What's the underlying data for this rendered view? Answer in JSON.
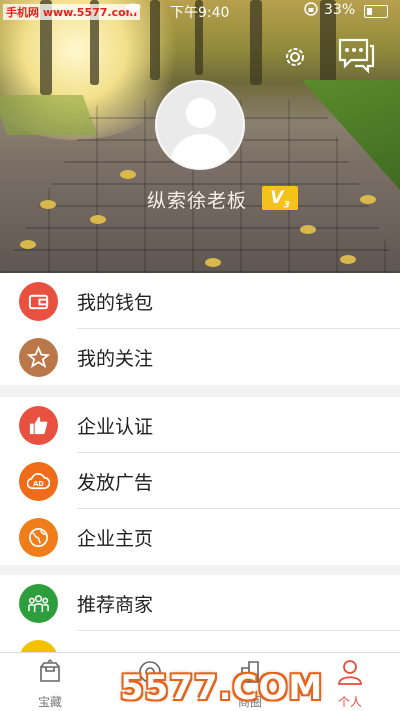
{
  "statusbar": {
    "watermark": "手机网 www.5577.com",
    "time": "下午9:40",
    "battery_pct": "33%"
  },
  "profile": {
    "username": "纵索徐老板",
    "vip_badge": "V",
    "vip_level": "3"
  },
  "menu_groups": [
    {
      "items": [
        {
          "label": "我的钱包",
          "icon": "wallet-icon",
          "color": "#e8513f"
        },
        {
          "label": "我的关注",
          "icon": "star-icon",
          "color": "#b9774a"
        }
      ]
    },
    {
      "items": [
        {
          "label": "企业认证",
          "icon": "thumbs-up-icon",
          "color": "#e8513f"
        },
        {
          "label": "发放广告",
          "icon": "ad-cloud-icon",
          "color": "#ef6c1a"
        },
        {
          "label": "企业主页",
          "icon": "globe-icon",
          "color": "#ef7d1a"
        }
      ]
    },
    {
      "items": [
        {
          "label": "推荐商家",
          "icon": "people-icon",
          "color": "#2e9e3c"
        },
        {
          "label": "",
          "icon": "partial-icon",
          "color": "#f2c200"
        }
      ]
    }
  ],
  "tabbar": {
    "tabs": [
      {
        "label": "宝藏",
        "icon": "treasure-icon",
        "active": false
      },
      {
        "label": "",
        "icon": "discover-icon",
        "active": false
      },
      {
        "label": "商圈",
        "icon": "building-icon",
        "active": false
      },
      {
        "label": "个人",
        "icon": "person-icon",
        "active": true
      }
    ]
  },
  "overlay_watermark": "5577.COM",
  "colors": {
    "accent": "#e84c3d",
    "vip": "#f4c21a"
  }
}
